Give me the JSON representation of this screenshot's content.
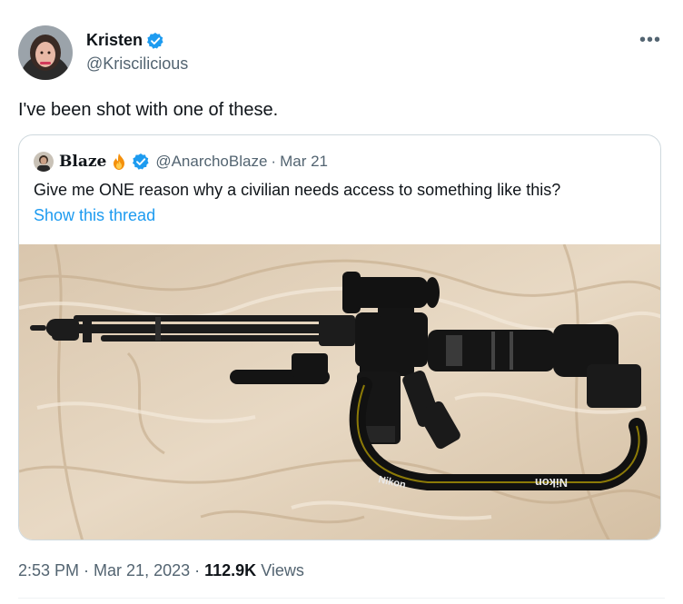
{
  "author": {
    "display_name": "Kristen",
    "handle": "@Kriscilicious",
    "verified": true
  },
  "tweet": {
    "text": "I've been shot with one of these.",
    "more_icon": "more-icon"
  },
  "quote": {
    "display_name": "Blaze",
    "emoji": "fire-icon",
    "handle": "@AnarchoBlaze",
    "separator": "·",
    "date": "Mar 21",
    "text": "Give me ONE reason why a civilian needs access to something like this?",
    "show_thread": "Show this thread",
    "strap_text": "Nikon"
  },
  "footer": {
    "time": "2:53 PM",
    "dot1": "·",
    "date": "Mar 21, 2023",
    "dot2": "·",
    "views_count": "112.9K",
    "views_label": "Views"
  },
  "colors": {
    "accent": "#1d9bf0",
    "text_primary": "#0f1419",
    "text_secondary": "#536471",
    "border": "#cfd9de"
  }
}
